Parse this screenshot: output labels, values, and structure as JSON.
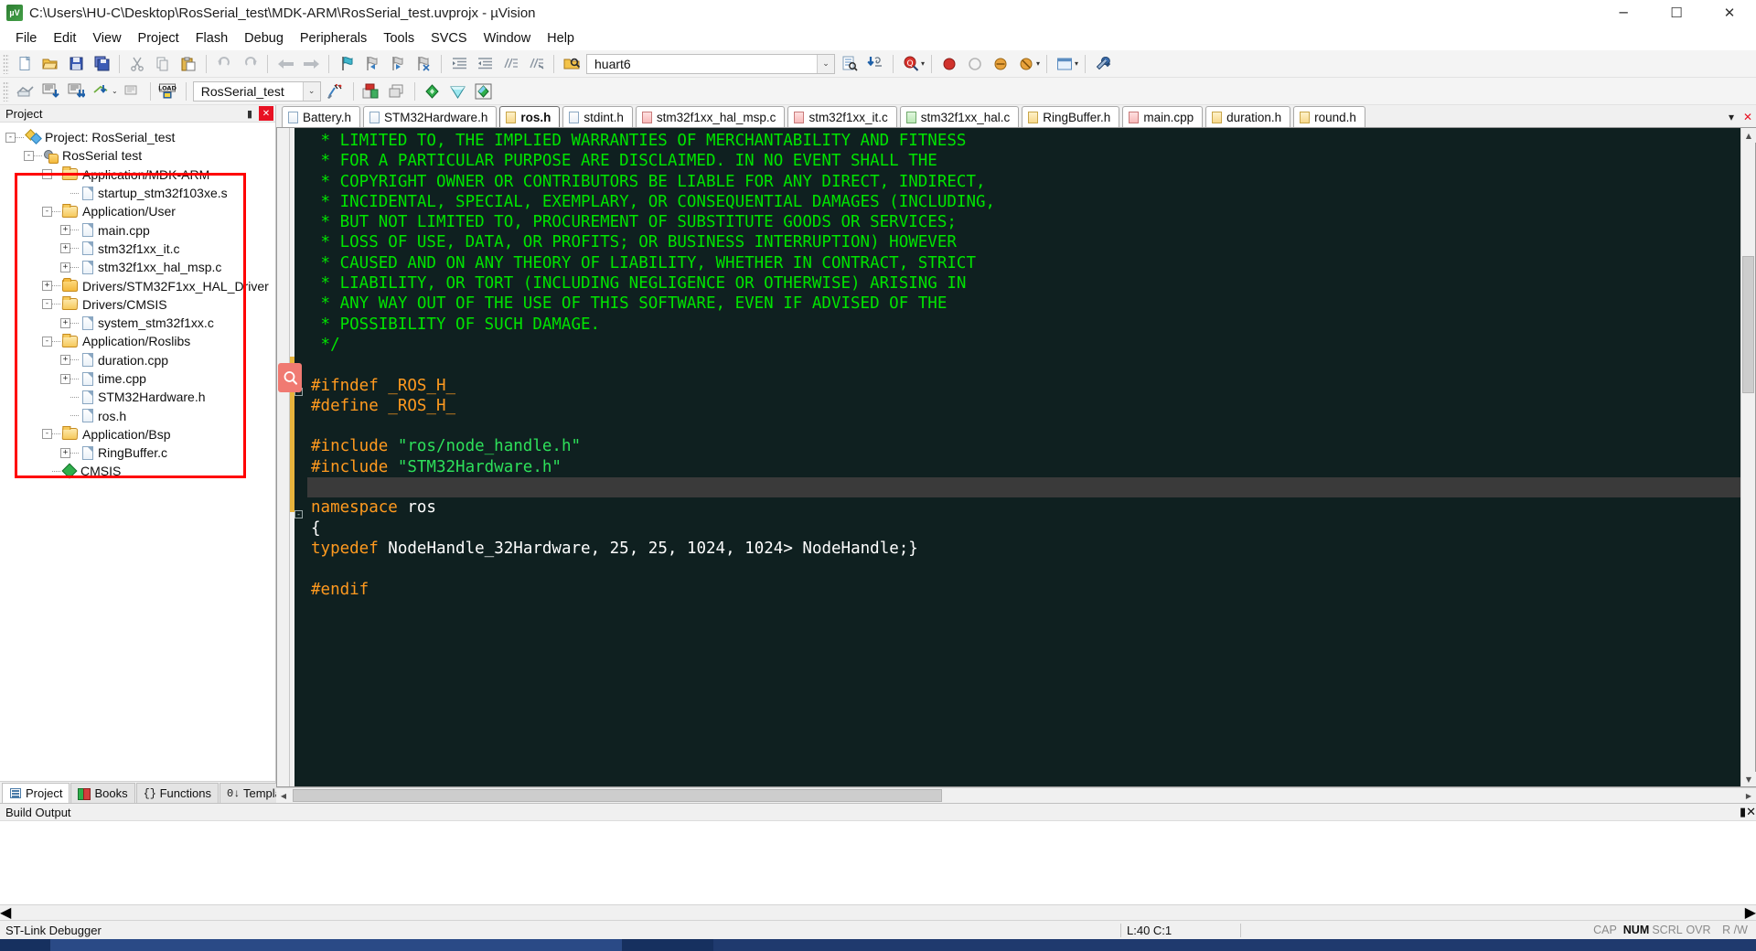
{
  "window": {
    "title": "C:\\Users\\HU-C\\Desktop\\RosSerial_test\\MDK-ARM\\RosSerial_test.uvprojx - µVision",
    "app_icon_text": "µV",
    "minimize": "─",
    "maximize": "☐",
    "close": "✕"
  },
  "menu": {
    "items": [
      {
        "label": "File"
      },
      {
        "label": "Edit"
      },
      {
        "label": "View"
      },
      {
        "label": "Project"
      },
      {
        "label": "Flash"
      },
      {
        "label": "Debug"
      },
      {
        "label": "Peripherals"
      },
      {
        "label": "Tools"
      },
      {
        "label": "SVCS"
      },
      {
        "label": "Window"
      },
      {
        "label": "Help"
      }
    ]
  },
  "toolbar_main": {
    "find_value": "huart6",
    "find_placeholder": "",
    "dropdown_arrow": "⌄",
    "zoom_caret": "▾"
  },
  "toolbar_build": {
    "target_value": "RosSerial_test",
    "dropdown_arrow": "⌄"
  },
  "project_pane": {
    "caption": "Project",
    "pin": "▮",
    "close": "✕",
    "tree": [
      {
        "depth": 0,
        "label": "Project: RosSerial_test",
        "icon": "project-icon",
        "expander": "-"
      },
      {
        "depth": 1,
        "label": "RosSerial test",
        "icon": "target-icon",
        "expander": "-"
      },
      {
        "depth": 2,
        "label": "Application/MDK-ARM",
        "icon": "folder-open-icon",
        "expander": "-"
      },
      {
        "depth": 3,
        "label": "startup_stm32f103xe.s",
        "icon": "file-icon",
        "expander": ""
      },
      {
        "depth": 2,
        "label": "Application/User",
        "icon": "folder-open-icon",
        "expander": "-"
      },
      {
        "depth": 3,
        "label": "main.cpp",
        "icon": "file-icon",
        "expander": "+"
      },
      {
        "depth": 3,
        "label": "stm32f1xx_it.c",
        "icon": "file-icon",
        "expander": "+"
      },
      {
        "depth": 3,
        "label": "stm32f1xx_hal_msp.c",
        "icon": "file-icon",
        "expander": "+"
      },
      {
        "depth": 2,
        "label": "Drivers/STM32F1xx_HAL_Driver",
        "icon": "folder-icon",
        "expander": "+"
      },
      {
        "depth": 2,
        "label": "Drivers/CMSIS",
        "icon": "folder-open-icon",
        "expander": "-"
      },
      {
        "depth": 3,
        "label": "system_stm32f1xx.c",
        "icon": "file-icon",
        "expander": "+"
      },
      {
        "depth": 2,
        "label": "Application/Roslibs",
        "icon": "folder-open-icon",
        "expander": "-"
      },
      {
        "depth": 3,
        "label": "duration.cpp",
        "icon": "file-icon",
        "expander": "+"
      },
      {
        "depth": 3,
        "label": "time.cpp",
        "icon": "file-icon",
        "expander": "+"
      },
      {
        "depth": 3,
        "label": "STM32Hardware.h",
        "icon": "file-icon",
        "expander": ""
      },
      {
        "depth": 3,
        "label": "ros.h",
        "icon": "file-icon",
        "expander": ""
      },
      {
        "depth": 2,
        "label": "Application/Bsp",
        "icon": "folder-open-icon",
        "expander": "-"
      },
      {
        "depth": 3,
        "label": "RingBuffer.c",
        "icon": "file-icon",
        "expander": "+"
      },
      {
        "depth": 2,
        "label": "CMSIS",
        "icon": "cmsis-icon",
        "expander": ""
      }
    ],
    "annotation_color": "#ff0000",
    "bottom_tabs": [
      {
        "label": "Project",
        "icon": "project-tab-icon",
        "active": true
      },
      {
        "label": "Books",
        "icon": "books-icon",
        "active": false
      },
      {
        "label": "Functions",
        "icon": "functions-icon",
        "active": false
      },
      {
        "label": "Templates",
        "icon": "templates-icon",
        "active": false
      }
    ]
  },
  "editor": {
    "tabs": [
      {
        "label": "Battery.h",
        "active": false,
        "color": "plain"
      },
      {
        "label": "STM32Hardware.h",
        "active": false,
        "color": "plain"
      },
      {
        "label": "ros.h",
        "active": true,
        "color": "a"
      },
      {
        "label": "stdint.h",
        "active": false,
        "color": "plain"
      },
      {
        "label": "stm32f1xx_hal_msp.c",
        "active": false,
        "color": "b"
      },
      {
        "label": "stm32f1xx_it.c",
        "active": false,
        "color": "b"
      },
      {
        "label": "stm32f1xx_hal.c",
        "active": false,
        "color": "c"
      },
      {
        "label": "RingBuffer.h",
        "active": false,
        "color": "a"
      },
      {
        "label": "main.cpp",
        "active": false,
        "color": "b"
      },
      {
        "label": "duration.h",
        "active": false,
        "color": "a"
      },
      {
        "label": "round.h",
        "active": false,
        "color": "a"
      }
    ],
    "tab_menu_icon": "▾",
    "tab_close_icon": "✕",
    "marker_icon": "search-marker-icon",
    "marker_color": "#f07a72",
    "background": "#0f2020",
    "lines": [
      {
        "text": " * LIMITED TO, THE IMPLIED WARRANTIES OF MERCHANTABILITY AND FITNESS",
        "style": "comment"
      },
      {
        "text": " * FOR A PARTICULAR PURPOSE ARE DISCLAIMED. IN NO EVENT SHALL THE",
        "style": "comment"
      },
      {
        "text": " * COPYRIGHT OWNER OR CONTRIBUTORS BE LIABLE FOR ANY DIRECT, INDIRECT,",
        "style": "comment"
      },
      {
        "text": " * INCIDENTAL, SPECIAL, EXEMPLARY, OR CONSEQUENTIAL DAMAGES (INCLUDING,",
        "style": "comment"
      },
      {
        "text": " * BUT NOT LIMITED TO, PROCUREMENT OF SUBSTITUTE GOODS OR SERVICES;",
        "style": "comment"
      },
      {
        "text": " * LOSS OF USE, DATA, OR PROFITS; OR BUSINESS INTERRUPTION) HOWEVER",
        "style": "comment"
      },
      {
        "text": " * CAUSED AND ON ANY THEORY OF LIABILITY, WHETHER IN CONTRACT, STRICT",
        "style": "comment"
      },
      {
        "text": " * LIABILITY, OR TORT (INCLUDING NEGLIGENCE OR OTHERWISE) ARISING IN",
        "style": "comment"
      },
      {
        "text": " * ANY WAY OUT OF THE USE OF THIS SOFTWARE, EVEN IF ADVISED OF THE",
        "style": "comment"
      },
      {
        "text": " * POSSIBILITY OF SUCH DAMAGE.",
        "style": "comment"
      },
      {
        "text": " */",
        "style": "comment"
      },
      {
        "text": "",
        "style": "blank"
      },
      {
        "text": "#ifndef _ROS_H_",
        "style": "pre"
      },
      {
        "text": "#define _ROS_H_",
        "style": "pre"
      },
      {
        "text": "",
        "style": "blank"
      },
      {
        "text": "#include \"ros/node_handle.h\"",
        "style": "include"
      },
      {
        "text": "#include \"STM32Hardware.h\"",
        "style": "include"
      },
      {
        "text": "",
        "style": "current"
      },
      {
        "text": "namespace ros",
        "style": "kw-plain"
      },
      {
        "text": "{",
        "style": "brace"
      },
      {
        "text": "typedef NodeHandle_<STM32Hardware, 25, 25, 1024, 1024> NodeHandle;}",
        "style": "typedef"
      },
      {
        "text": "",
        "style": "blank"
      },
      {
        "text": "#endif",
        "style": "pre"
      }
    ]
  },
  "build_output": {
    "caption": "Build Output",
    "pin": "▮",
    "close": "✕",
    "content": ""
  },
  "statusbar": {
    "debugger": "ST-Link Debugger",
    "position": "L:40 C:1",
    "indicators": [
      {
        "label": "CAP",
        "on": false
      },
      {
        "label": "NUM",
        "on": true
      },
      {
        "label": "SCRL",
        "on": false
      },
      {
        "label": "OVR",
        "on": false
      },
      {
        "label": "R /W",
        "on": false
      }
    ]
  }
}
